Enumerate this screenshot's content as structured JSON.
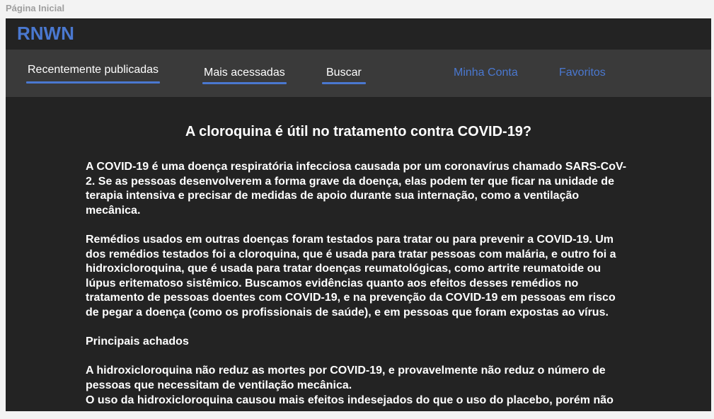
{
  "frame": {
    "label": "Página Inicial"
  },
  "header": {
    "logo": "RNWN"
  },
  "nav": {
    "tabs": [
      {
        "label": "Recentemente publicadas"
      },
      {
        "label": "Mais acessadas"
      },
      {
        "label": "Buscar"
      }
    ],
    "links": [
      {
        "label": "Minha Conta"
      },
      {
        "label": "Favoritos"
      }
    ]
  },
  "article": {
    "title": "A cloroquina é útil no tratamento contra COVID-19?",
    "paragraphs": [
      "A COVID-19 é uma doença respiratória infecciosa causada por um coronavírus chamado SARS-CoV-2. Se as pessoas desenvolverem a forma grave da doença, elas podem ter que ficar na unidade de terapia intensiva e precisar de medidas de apoio durante sua internação, como a ventilação mecânica.",
      "Remédios usados em outras doenças foram testados para tratar ou para prevenir a COVID-19. Um dos remédios testados foi a cloroquina, que é usada para tratar pessoas com malária, e outro foi a hidroxicloroquina, que é usada para tratar doenças reumatológicas, como artrite reumatoide ou lúpus eritematoso sistêmico. Buscamos evidências quanto aos efeitos desses remédios no tratamento de pessoas doentes com COVID-19, e na prevenção da COVID-19 em pessoas em risco de pegar a doença (como os profissionais de saúde), e em pessoas que foram expostas ao vírus.",
      "Principais achados",
      "A hidroxicloroquina não reduz as mortes por COVID-19, e provavelmente não reduz o número de pessoas que necessitam de ventilação mecânica.",
      "O uso da hidroxicloroquina causou mais efeitos indesejados do que o uso do placebo, porém não"
    ]
  },
  "colors": {
    "accent": "#4a78d0",
    "background": "#232323",
    "navbar": "#3a3a3a",
    "text": "#ffffff"
  }
}
